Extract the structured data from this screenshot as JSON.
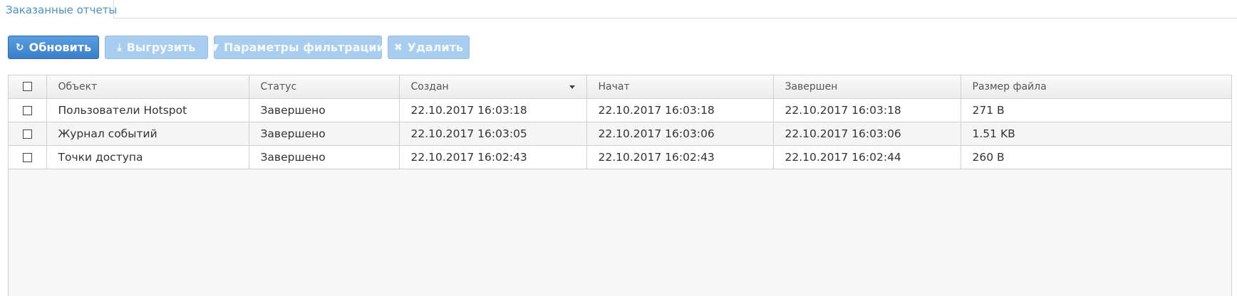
{
  "tabs": [
    {
      "label": "Заказанные отчеты",
      "active": true
    }
  ],
  "toolbar": {
    "refresh": {
      "icon": "refresh-icon",
      "label": "Обновить",
      "enabled": true
    },
    "export": {
      "icon": "download-icon",
      "label": "Выгрузить",
      "enabled": false
    },
    "filter": {
      "icon": "filter-icon",
      "label": "Параметры фильтрации",
      "enabled": false
    },
    "delete": {
      "icon": "close-icon",
      "label": "Удалить",
      "enabled": false
    }
  },
  "colors": {
    "accent": "#3a7fcb",
    "tab_text": "#4a90c8",
    "disabled_button": "#a9cdef"
  },
  "table": {
    "columns": [
      "Объект",
      "Статус",
      "Создан",
      "Начат",
      "Завершен",
      "Размер файла"
    ],
    "sorted_column": "Создан",
    "sort_direction": "desc",
    "rows": [
      {
        "object": "Пользователи Hotspot",
        "status": "Завершено",
        "created": "22.10.2017 16:03:18",
        "started": "22.10.2017 16:03:18",
        "finished": "22.10.2017 16:03:18",
        "size": "271 B",
        "checked": false
      },
      {
        "object": "Журнал событий",
        "status": "Завершено",
        "created": "22.10.2017 16:03:05",
        "started": "22.10.2017 16:03:06",
        "finished": "22.10.2017 16:03:06",
        "size": "1.51 KB",
        "checked": false
      },
      {
        "object": "Точки доступа",
        "status": "Завершено",
        "created": "22.10.2017 16:02:43",
        "started": "22.10.2017 16:02:43",
        "finished": "22.10.2017 16:02:44",
        "size": "260 B",
        "checked": false
      }
    ]
  }
}
